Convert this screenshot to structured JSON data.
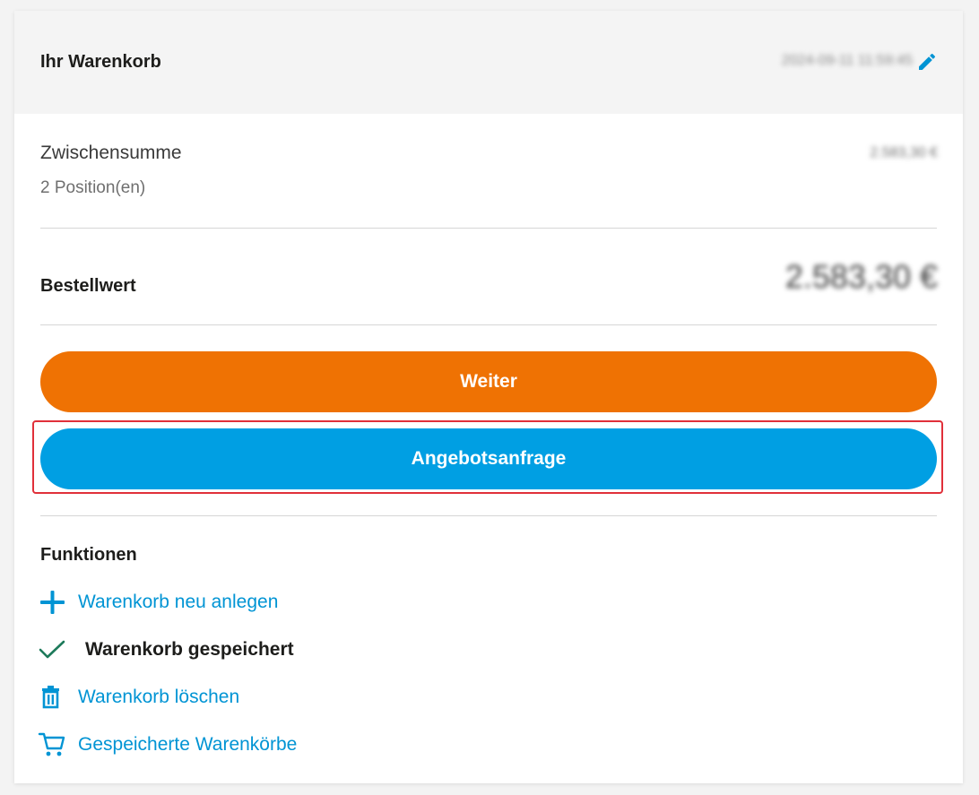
{
  "header": {
    "title": "Ihr Warenkorb",
    "date": "2024-09-11 11:59:45",
    "edit_icon": "pencil-icon"
  },
  "summary": {
    "subtotal_label": "Zwischensumme",
    "positions": "2 Position(en)",
    "subtotal_value": "2.583,30 €",
    "order_value_label": "Bestellwert",
    "order_value": "2.583,30 €"
  },
  "buttons": {
    "continue_label": "Weiter",
    "quote_label": "Angebotsanfrage"
  },
  "functions": {
    "title": "Funktionen",
    "items": [
      {
        "label": "Warenkorb neu anlegen",
        "icon": "plus-icon"
      },
      {
        "label": "Warenkorb gespeichert",
        "icon": "check-icon"
      },
      {
        "label": "Warenkorb löschen",
        "icon": "trash-icon"
      },
      {
        "label": "Gespeicherte Warenkörbe",
        "icon": "cart-icon"
      }
    ]
  },
  "colors": {
    "orange": "#ef7203",
    "blue": "#009fe3",
    "link": "#0094d4",
    "check": "#1d7a5a",
    "highlight": "#e0303a"
  }
}
